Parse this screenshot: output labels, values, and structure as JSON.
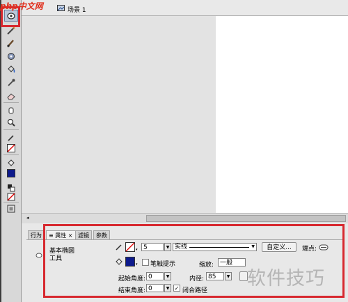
{
  "logo": {
    "text": "php中文网"
  },
  "topbar": {
    "scene_label": "场景 1"
  },
  "panel": {
    "tabs": [
      {
        "label": "行为"
      },
      {
        "label": "属性"
      },
      {
        "label": "滤镜"
      },
      {
        "label": "参数"
      }
    ],
    "tool_name": "基本椭圆\n工具",
    "stroke_width": "5",
    "stroke_style": "实线",
    "custom_button": "自定义...",
    "cap_label": "端点:",
    "stroke_hint_label": "笔触提示",
    "scale_label": "缩放:",
    "scale_value": "一般",
    "start_angle_label": "起始角度:",
    "start_angle_value": "0",
    "end_angle_label": "结束角度:",
    "end_angle_value": "0",
    "inner_radius_label": "内径:",
    "inner_radius_value": "85",
    "close_path_label": "闭合路径",
    "close_path_checked": true,
    "stroke_hint_checked": false
  },
  "watermark": {
    "text": "软件技巧"
  },
  "colors": {
    "highlight": "#d7282f",
    "fill_swatch": "#0d1a8c"
  }
}
